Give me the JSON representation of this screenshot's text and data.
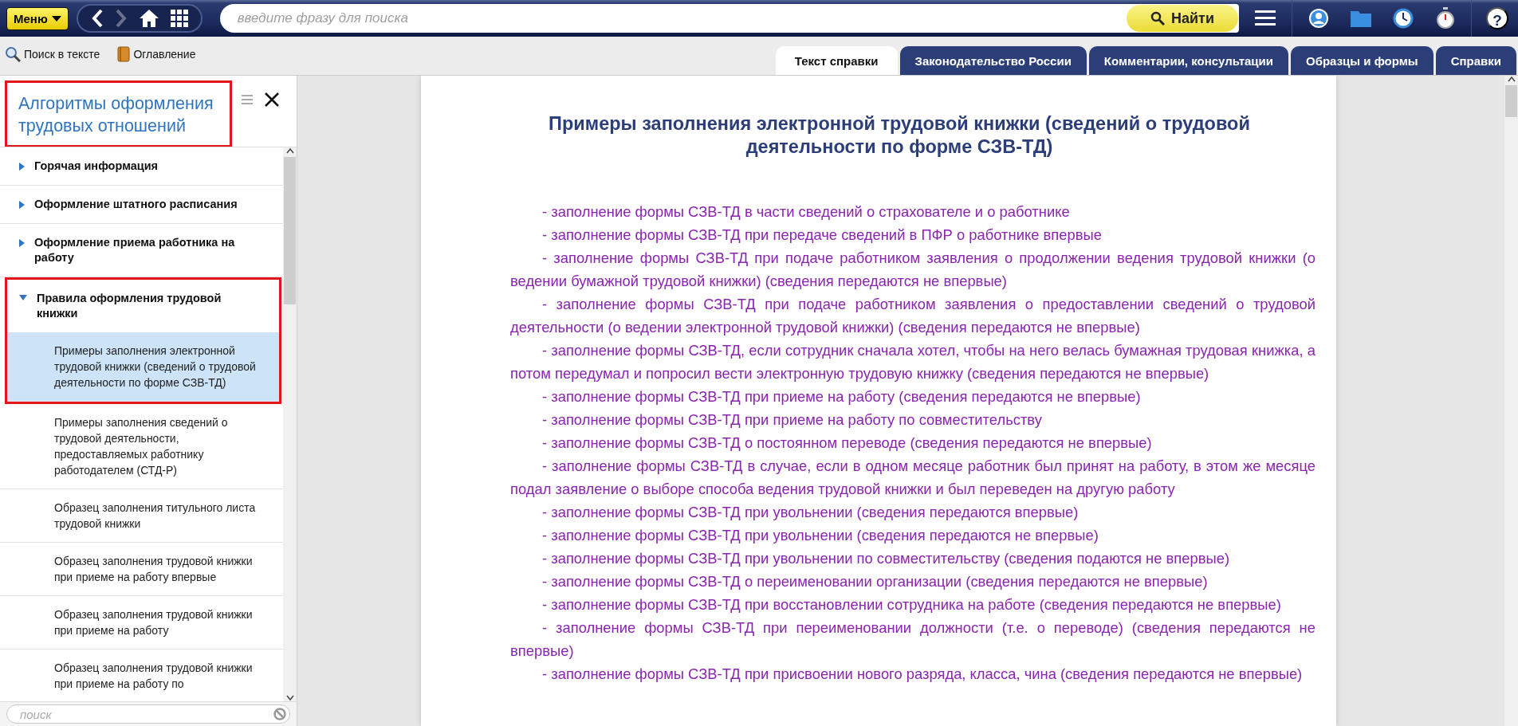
{
  "topbar": {
    "menu_button": "Меню",
    "nav": {
      "back_disabled": false,
      "forward_disabled": true
    },
    "search": {
      "placeholder": "введите фразу для поиска"
    },
    "find_button": "Найти",
    "help": "?"
  },
  "toolbar": {
    "buttons": [
      {
        "kind": "search",
        "label": "Поиск в тексте"
      },
      {
        "kind": "book",
        "label": "Оглавление"
      }
    ]
  },
  "tabs": [
    {
      "label": "Текст справки",
      "selected": true
    },
    {
      "label": "Законодательство России",
      "selected": false
    },
    {
      "label": "Комментарии, консультации",
      "selected": false
    },
    {
      "label": "Образцы и формы",
      "selected": false
    },
    {
      "label": "Справки",
      "selected": false
    }
  ],
  "sidebar": {
    "title": "Алгоритмы оформления трудовых отношений",
    "title_highlighted": true,
    "items": [
      {
        "label": "Горячая информация",
        "expanded": false,
        "highlighted": false
      },
      {
        "label": "Оформление штатного расписания",
        "expanded": false,
        "highlighted": false
      },
      {
        "label": "Оформление приема работника на работу",
        "expanded": false,
        "highlighted": false
      },
      {
        "label": "Правила оформления трудовой книжки",
        "expanded": true,
        "highlighted": true,
        "children": [
          {
            "label": "Примеры заполнения электронной трудовой книжки (сведений о трудовой деятельности по форме СЗВ-ТД)",
            "selected": true
          },
          {
            "label": "Примеры заполнения сведений о трудовой деятельности, предоставляемых работнику работодателем (СТД-Р)",
            "selected": false
          },
          {
            "label": "Образец заполнения титульного листа трудовой книжки",
            "selected": false
          },
          {
            "label": "Образец заполнения трудовой книжки при приеме на работу впервые",
            "selected": false
          },
          {
            "label": "Образец заполнения трудовой книжки при приеме на работу",
            "selected": false
          },
          {
            "label": "Образец заполнения трудовой книжки при приеме на работу по",
            "selected": false
          }
        ]
      }
    ],
    "search": {
      "placeholder": "поиск"
    }
  },
  "document": {
    "title": "Примеры заполнения электронной трудовой книжки (сведений о трудовой деятельности по форме СЗВ-ТД)",
    "links": [
      "- заполнение формы СЗВ-ТД в части сведений о страхователе и о работнике",
      "- заполнение формы СЗВ-ТД при передаче сведений в ПФР о работнике впервые",
      "- заполнение формы СЗВ-ТД при подаче работником заявления о продолжении ведения трудовой книжки (о ведении бумажной трудовой книжки) (сведения передаются не впервые)",
      "- заполнение формы СЗВ-ТД при подаче работником заявления о предоставлении сведений о трудовой деятельности (о ведении электронной трудовой книжки) (сведения передаются не впервые)",
      "- заполнение формы СЗВ-ТД, если сотрудник сначала хотел, чтобы на него велась бумажная трудовая книжка, а потом передумал и попросил вести электронную трудовую книжку (сведения передаются не впервые)",
      "- заполнение формы СЗВ-ТД при приеме на работу (сведения передаются не впервые)",
      "- заполнение формы СЗВ-ТД при приеме на работу по совместительству",
      "- заполнение формы СЗВ-ТД о постоянном переводе (сведения передаются не впервые)",
      "- заполнение формы СЗВ-ТД в случае, если в одном месяце работник был принят на работу, в этом же месяце подал заявление о выборе способа ведения трудовой книжки и был переведен на другую работу",
      "- заполнение формы СЗВ-ТД при увольнении (сведения передаются впервые)",
      "- заполнение формы СЗВ-ТД при увольнении (сведения передаются не впервые)",
      "- заполнение формы СЗВ-ТД при увольнении по совместительству (сведения подаются не впервые)",
      "- заполнение формы СЗВ-ТД о переименовании организации (сведения передаются не впервые)",
      "- заполнение формы СЗВ-ТД при восстановлении сотрудника на работе (сведения передаются не впервые)",
      "- заполнение формы СЗВ-ТД при переименовании должности (т.е. о переводе) (сведения передаются не впервые)",
      "- заполнение формы СЗВ-ТД при присвоении нового разряда, класса, чина (сведения передаются не впервые)"
    ]
  }
}
